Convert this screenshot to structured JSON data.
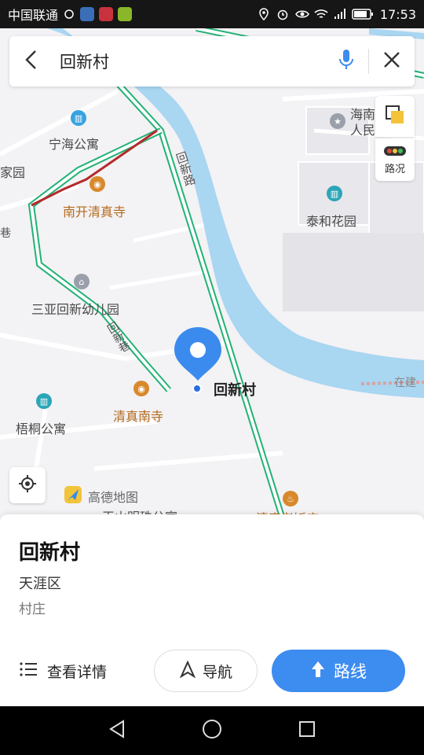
{
  "status_bar": {
    "carrier": "中国联通",
    "time": "17:53"
  },
  "search": {
    "query": "回新村"
  },
  "map": {
    "pois": {
      "ninghai": "宁海公寓",
      "jiayuan": "家园",
      "nankai_mosque": "南开清真寺",
      "sanya_kindergarten": "三亚回新幼儿园",
      "qingzhen_nansi": "清真南寺",
      "wutong": "梧桐公寓",
      "taihe": "泰和花园",
      "haihan_hospital_1": "海南",
      "haihan_hospital_2": "人民检察院",
      "bottom_poi_1": "玉山明珠公寓",
      "bottom_poi_2": "清真老饭店",
      "under_construction": "在建"
    },
    "roads": {
      "huixin_road": "回新路",
      "huixin_lane": "回新巷",
      "left_road": "巷"
    },
    "pin_label": "回新村",
    "watermark": "高德地图",
    "traffic_label": "路况"
  },
  "card": {
    "title": "回新村",
    "district": "天涯区",
    "type": "村庄",
    "detail_label": "查看详情",
    "nav_label": "导航",
    "route_label": "路线"
  },
  "colors": {
    "accent": "#3d8cf0",
    "water": "#a9d6f1",
    "road_green": "#23b275",
    "poi_orange": "#d8892c"
  }
}
